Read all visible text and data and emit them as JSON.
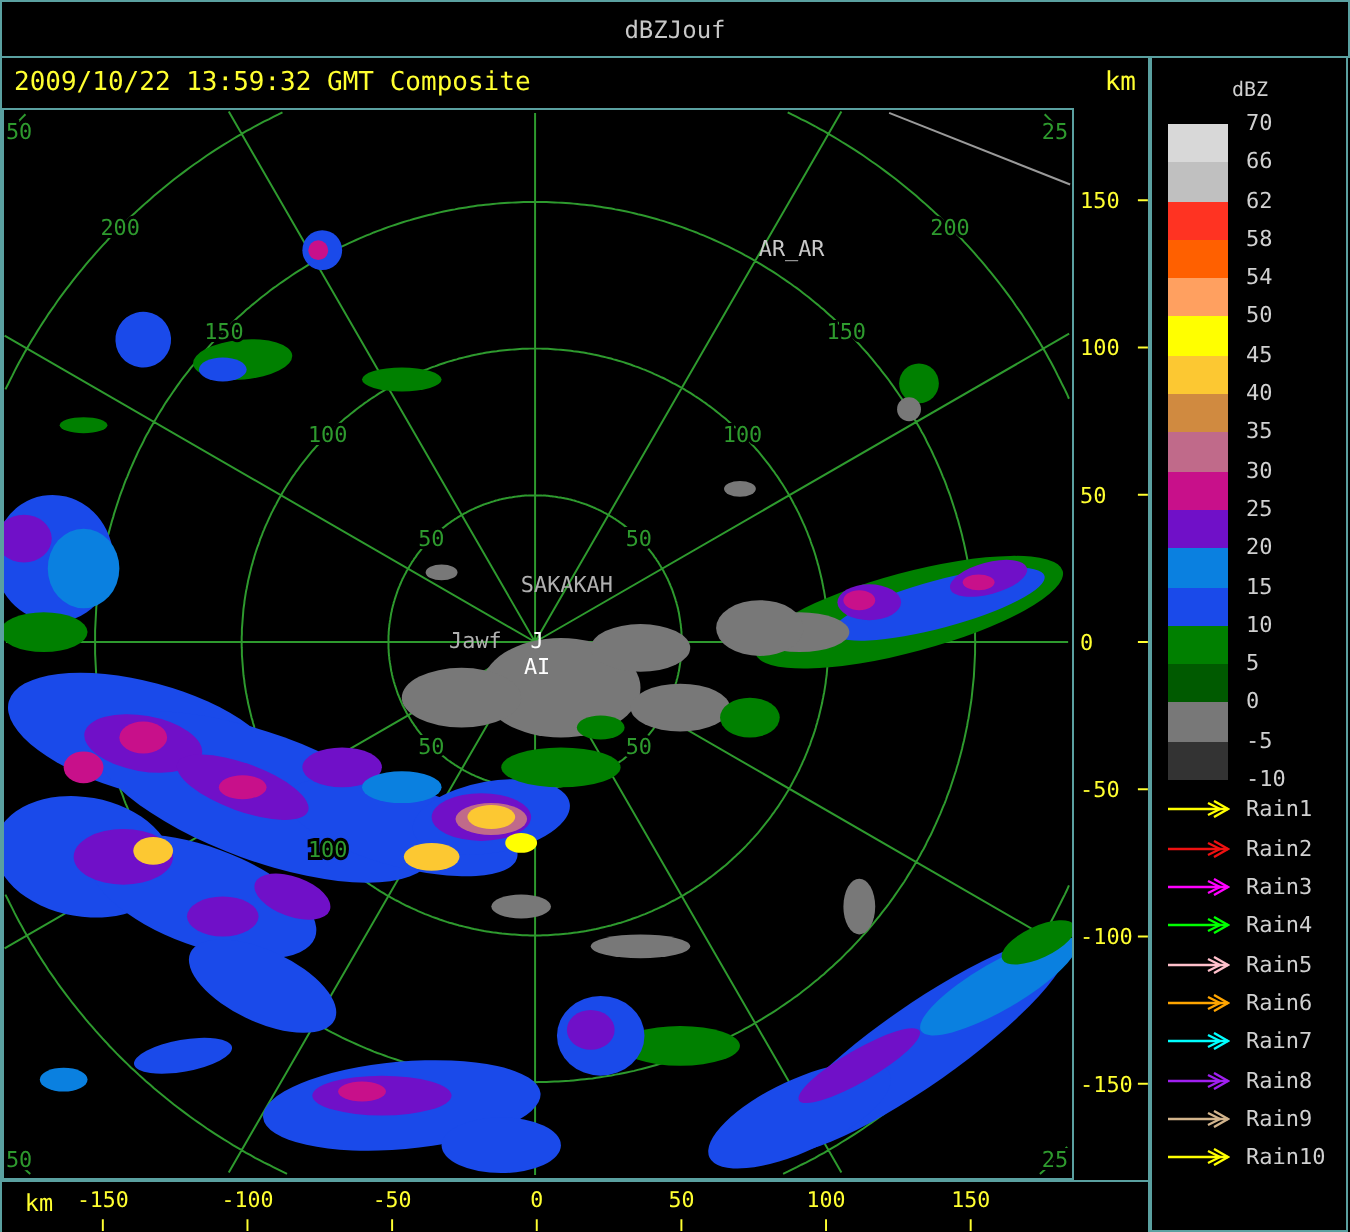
{
  "window": {
    "title": "dBZJouf"
  },
  "header": {
    "caption": "2009/10/22 13:59:32 GMT Composite",
    "unit": "km"
  },
  "plot": {
    "ring_labels": [
      "50",
      "25",
      "200",
      "200",
      "150",
      "150",
      "100",
      "100",
      "50",
      "50",
      "50",
      "50",
      "100",
      "50",
      "25"
    ],
    "place_labels": [
      {
        "text": "AR_AR"
      },
      {
        "text": "SAKAKAH"
      },
      {
        "text": "Jawf"
      },
      {
        "text": "J"
      },
      {
        "text": "AI"
      }
    ],
    "y_axis": {
      "labels": [
        "150",
        "100",
        "50",
        "0",
        "-50",
        "-100",
        "-150"
      ]
    },
    "x_axis": {
      "unit": "km",
      "labels": [
        "-150",
        "-100",
        "-50",
        "0",
        "50",
        "100",
        "150"
      ]
    }
  },
  "legend": {
    "title": "dBZ",
    "scale_bands": [
      {
        "color": "#d8d8d8"
      },
      {
        "color": "#c0c0c0"
      },
      {
        "color": "#ff3322"
      },
      {
        "color": "#ff6000"
      },
      {
        "color": "#ffa060"
      },
      {
        "color": "#ffff00"
      },
      {
        "color": "#fcc832"
      },
      {
        "color": "#d08a40"
      },
      {
        "color": "#c06a8a"
      },
      {
        "color": "#c8108a"
      },
      {
        "color": "#7010c8"
      },
      {
        "color": "#0a80e0"
      },
      {
        "color": "#1a4aea"
      },
      {
        "color": "#008000"
      },
      {
        "color": "#005a00"
      },
      {
        "color": "#787878"
      },
      {
        "color": "#333333"
      }
    ],
    "scale_labels": [
      "70",
      "66",
      "62",
      "58",
      "54",
      "50",
      "45",
      "40",
      "35",
      "30",
      "25",
      "20",
      "15",
      "10",
      "5",
      "0",
      "-5",
      "-10"
    ],
    "tracks": [
      {
        "label": "Rain1",
        "color": "#ffff00"
      },
      {
        "label": "Rain2",
        "color": "#ee1111"
      },
      {
        "label": "Rain3",
        "color": "#ff00ff"
      },
      {
        "label": "Rain4",
        "color": "#00ff00"
      },
      {
        "label": "Rain5",
        "color": "#ffc0cb"
      },
      {
        "label": "Rain6",
        "color": "#ffa500"
      },
      {
        "label": "Rain7",
        "color": "#00ffff"
      },
      {
        "label": "Rain8",
        "color": "#a020f0"
      },
      {
        "label": "Rain9",
        "color": "#d2b48c"
      },
      {
        "label": "Rain10",
        "color": "#ffff00"
      }
    ]
  }
}
